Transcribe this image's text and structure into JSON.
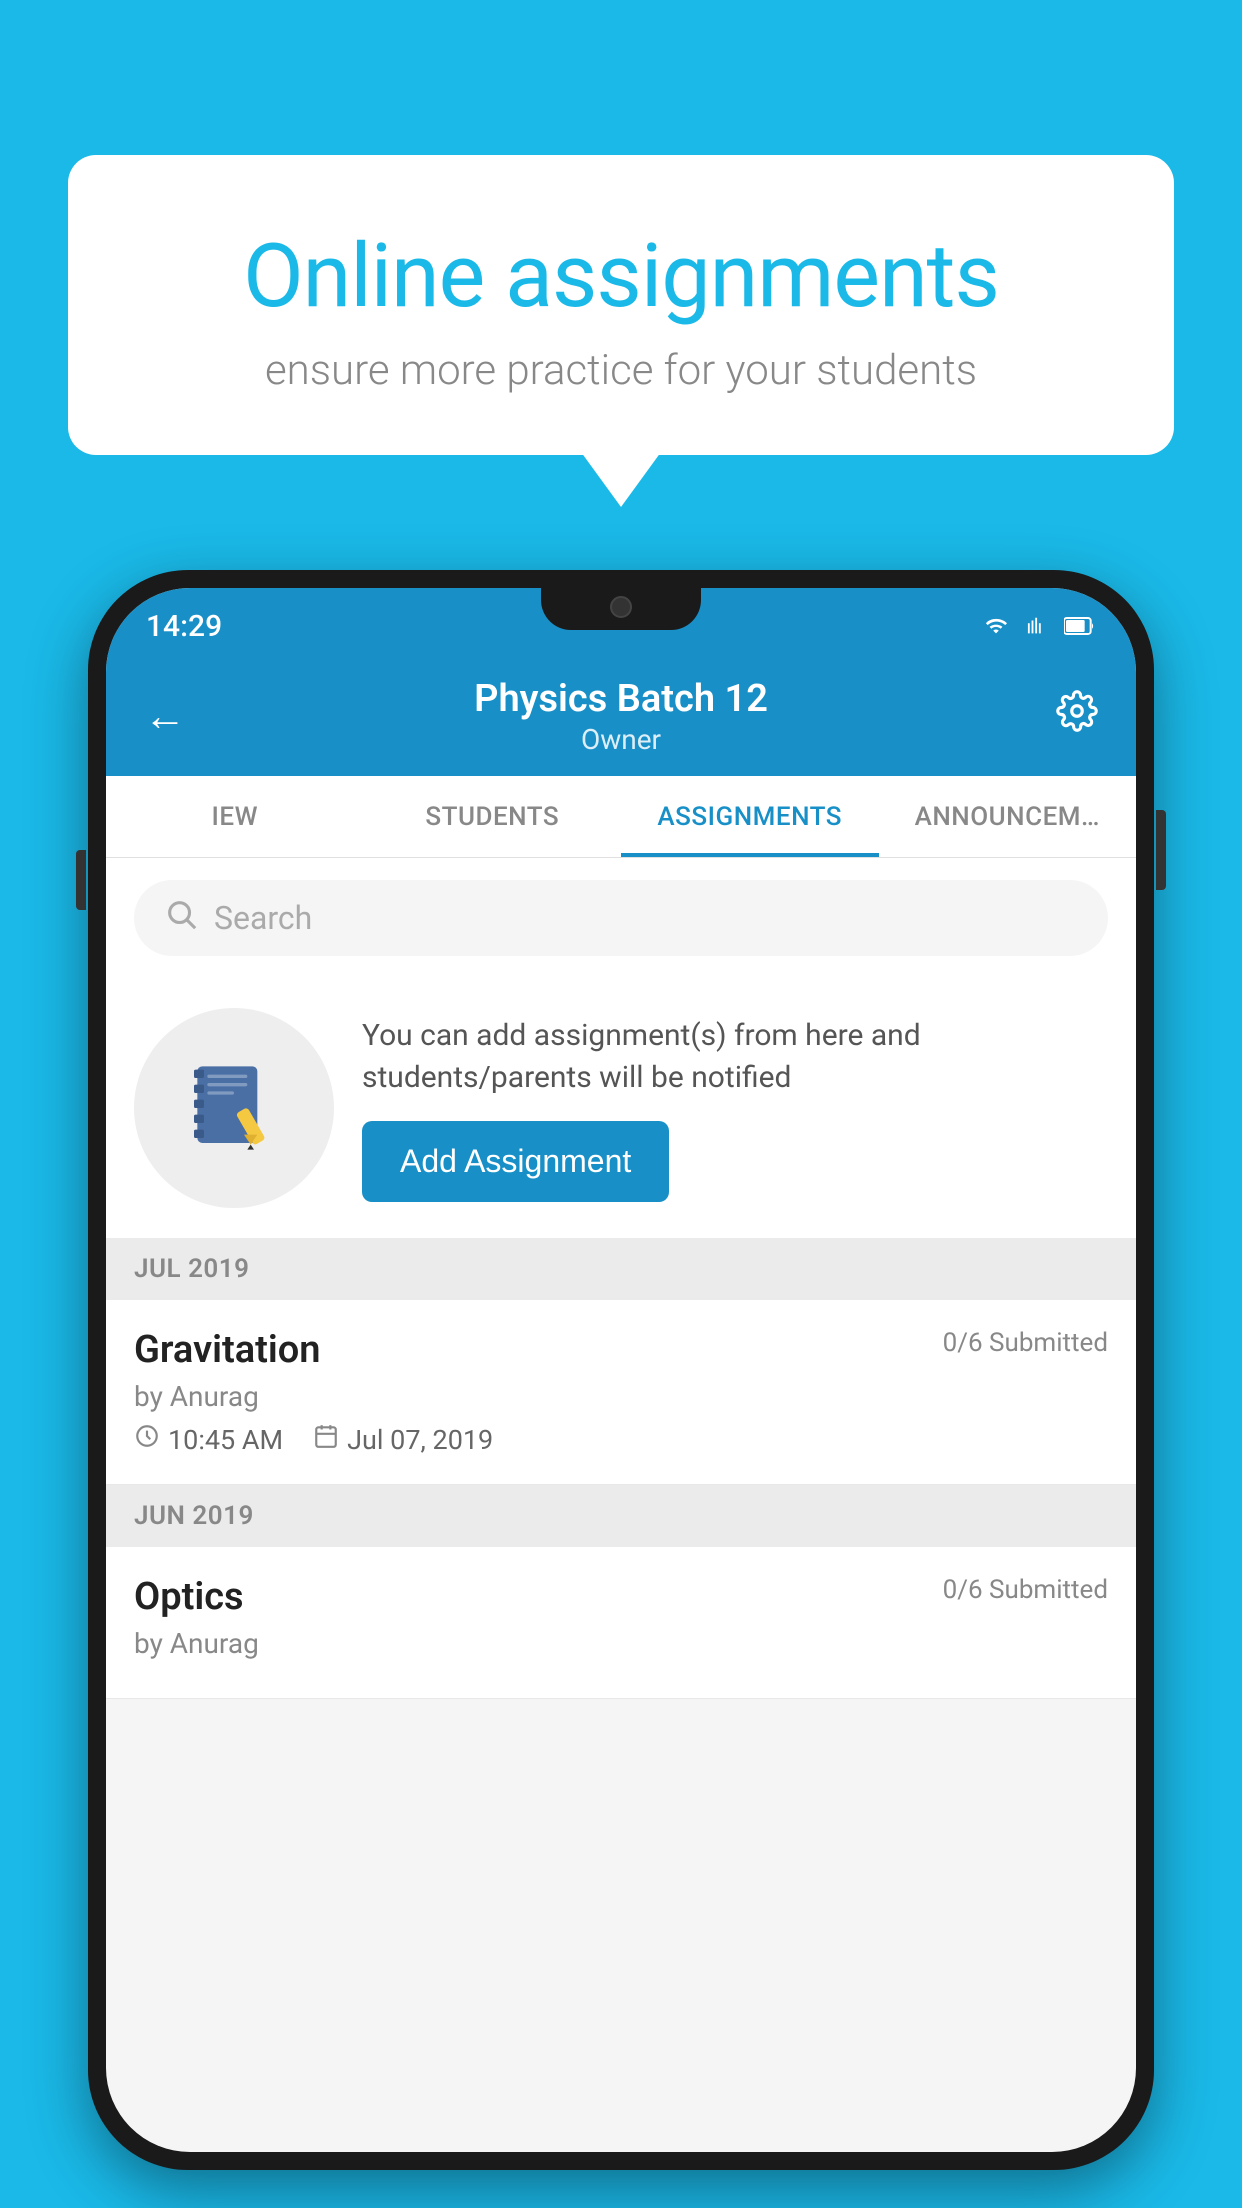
{
  "background_color": "#1ab9e8",
  "speech_bubble": {
    "title": "Online assignments",
    "subtitle": "ensure more practice for your students"
  },
  "phone": {
    "status_bar": {
      "time": "14:29"
    },
    "header": {
      "title": "Physics Batch 12",
      "subtitle": "Owner",
      "back_icon": "←",
      "settings_icon": "⚙"
    },
    "tabs": [
      {
        "label": "IEW",
        "active": false
      },
      {
        "label": "STUDENTS",
        "active": false
      },
      {
        "label": "ASSIGNMENTS",
        "active": true
      },
      {
        "label": "ANNOUNCEM…",
        "active": false
      }
    ],
    "search": {
      "placeholder": "Search"
    },
    "promo": {
      "description": "You can add assignment(s) from here and students/parents will be notified",
      "button_label": "Add Assignment"
    },
    "sections": [
      {
        "month_label": "JUL 2019",
        "assignments": [
          {
            "title": "Gravitation",
            "submitted": "0/6 Submitted",
            "author": "by Anurag",
            "time": "10:45 AM",
            "date": "Jul 07, 2019"
          }
        ]
      },
      {
        "month_label": "JUN 2019",
        "assignments": [
          {
            "title": "Optics",
            "submitted": "0/6 Submitted",
            "author": "by Anurag",
            "time": "",
            "date": ""
          }
        ]
      }
    ]
  }
}
